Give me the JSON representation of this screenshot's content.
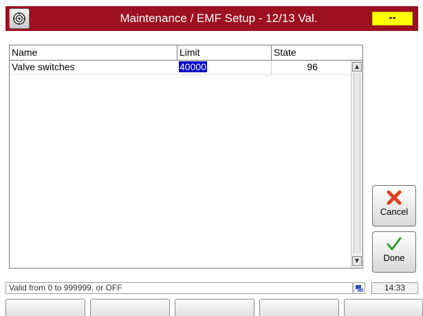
{
  "header": {
    "title": "Maintenance / EMF Setup - 12/13 Val.",
    "status_indicator": "--",
    "app_icon": "gear-icon"
  },
  "table": {
    "columns": [
      "Name",
      "Limit",
      "State"
    ],
    "rows": [
      {
        "name": "Valve switches",
        "limit": "40000",
        "state": "96"
      }
    ],
    "selected_cell": "limit"
  },
  "buttons": {
    "cancel": {
      "label": "Cancel",
      "icon": "x-icon"
    },
    "done": {
      "label": "Done",
      "icon": "checkmark-icon"
    }
  },
  "statusbar": {
    "message": "Valid from 0 to 999999, or OFF",
    "network_icon": "network-icon",
    "time": "14:33"
  },
  "softkeys": [
    "",
    "",
    "",
    "",
    ""
  ],
  "colors": {
    "titlebar": "#9c1020",
    "status_indicator": "#ffff00",
    "selection": "#0000c8",
    "cancel_icon": "#e04020",
    "done_icon": "#2ea02e"
  }
}
